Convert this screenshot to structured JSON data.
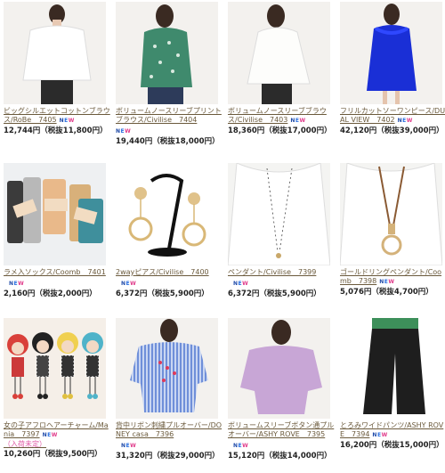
{
  "new_badge": "NEW",
  "products": [
    {
      "title": "ビッグシルエットコットンブラウス/RoBe　7405",
      "price": "12,744円（税抜11,800円）",
      "new": true,
      "icon": "white-blouse-photo"
    },
    {
      "title": "ボリュームノースリーブプリントブラウス/Civilise　7404",
      "price": "19,440円（税抜18,000円）",
      "new": true,
      "icon": "green-print-blouse-photo"
    },
    {
      "title": "ボリュームノースリーブブラウス/Civilise　7403",
      "price": "18,360円（税抜17,000円）",
      "new": true,
      "icon": "white-sleeveless-blouse-photo"
    },
    {
      "title": "フリルカットソーワンピース/DUAL VIEW　7402",
      "price": "42,120円（税抜39,000円）",
      "new": true,
      "icon": "blue-dress-photo"
    },
    {
      "title": "ラメ入ソックス/Coomb　7401",
      "price": "2,160円（税抜2,000円）",
      "new": true,
      "icon": "socks-photo"
    },
    {
      "title": "2wayピアス/Civilise　7400",
      "price": "6,372円（税抜5,900円）",
      "new": true,
      "icon": "earrings-photo"
    },
    {
      "title": "ペンダント/Civilise　7399",
      "price": "6,372円（税抜5,900円）",
      "new": true,
      "icon": "pendant-photo"
    },
    {
      "title": "ゴールドリングペンダント/Coomb　7398",
      "price": "5,076円（税抜4,700円）",
      "new": true,
      "icon": "ring-pendant-photo"
    },
    {
      "title": "女の子アフロヘアーチャーム/Mania　7397",
      "note": "（入荷未定）",
      "price": "10,260円（税抜9,500円）",
      "new": true,
      "icon": "dolls-charm-photo"
    },
    {
      "title": "背中リボン刺繍プルオーバー/DONEY casa　7396",
      "price": "31,320円（税抜29,000円）",
      "new": true,
      "icon": "striped-pullover-photo"
    },
    {
      "title": "ボリュームスリーブボタン通プルオーバー/ASHY ROVE　7395",
      "price": "15,120円（税抜14,000円）",
      "new": true,
      "icon": "lavender-pullover-photo"
    },
    {
      "title": "とろみワイドパンツ/ASHY ROVE　7394",
      "price": "16,200円（税抜15,000円）",
      "new": true,
      "icon": "wide-pants-photo"
    }
  ]
}
